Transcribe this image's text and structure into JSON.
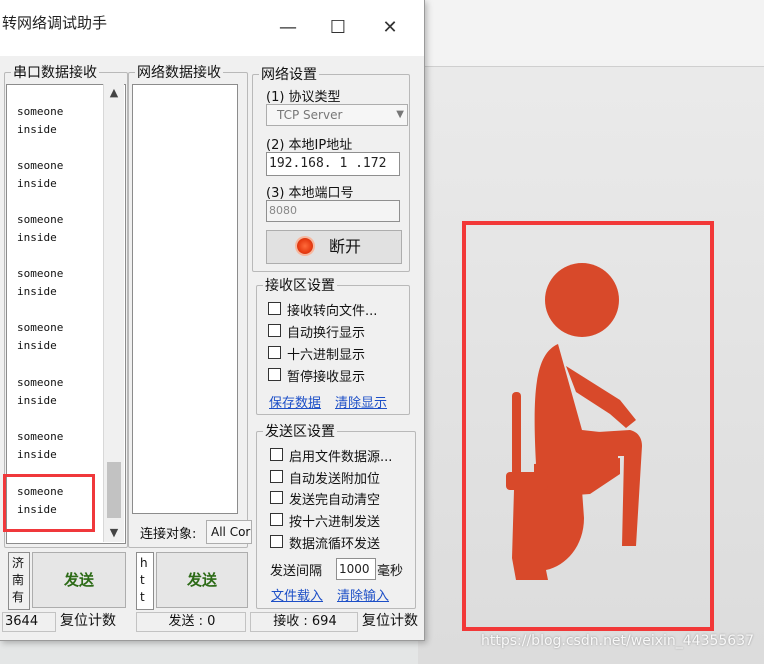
{
  "window": {
    "title": "转网络调试助手",
    "minimize": "—",
    "maximize": "☐",
    "close": "✕"
  },
  "serial_rx": {
    "label": "串口数据接收",
    "lines": [
      "someone",
      "inside",
      "someone",
      "inside",
      "someone",
      "inside",
      "someone",
      "inside",
      "someone",
      "inside",
      "someone",
      "inside",
      "someone",
      "inside",
      "someone",
      "inside"
    ],
    "side_text": [
      "济",
      "南",
      "有"
    ],
    "send_button": "发送"
  },
  "net_rx": {
    "label": "网络数据接收",
    "connect_label": "连接对象:",
    "connect_value": "All Cor",
    "side_text": [
      "h",
      "t",
      "t"
    ],
    "send_button": "发送"
  },
  "net_settings": {
    "label": "网络设置",
    "protocol_label": "(1) 协议类型",
    "protocol_value": "TCP Server",
    "ip_label": "(2) 本地IP地址",
    "ip_value": "192.168. 1 .172",
    "port_label": "(3) 本地端口号",
    "port_value": "8080",
    "disconnect_button": "断开"
  },
  "rx_settings": {
    "label": "接收区设置",
    "options": [
      "接收转向文件...",
      "自动换行显示",
      "十六进制显示",
      "暂停接收显示"
    ],
    "save_link": "保存数据",
    "clear_link": "清除显示"
  },
  "tx_settings": {
    "label": "发送区设置",
    "options": [
      "启用文件数据源...",
      "自动发送附加位",
      "发送完自动清空",
      "按十六进制发送",
      "数据流循环发送"
    ],
    "interval_label": "发送间隔",
    "interval_value": "1000",
    "interval_unit": "毫秒",
    "file_link": "文件载入",
    "clear_link": "清除输入"
  },
  "status_bar": {
    "left_count": "3644",
    "reset1": "复位计数",
    "sent": "发送 : 0",
    "received": "接收 : 694",
    "reset2": "复位计数"
  },
  "watermark": "https://blog.csdn.net/weixin_44355637",
  "colors": {
    "pictogram": "#d8492a",
    "frame": "#f23838",
    "link": "#1d4fc7",
    "send_text": "#2d6b17"
  }
}
